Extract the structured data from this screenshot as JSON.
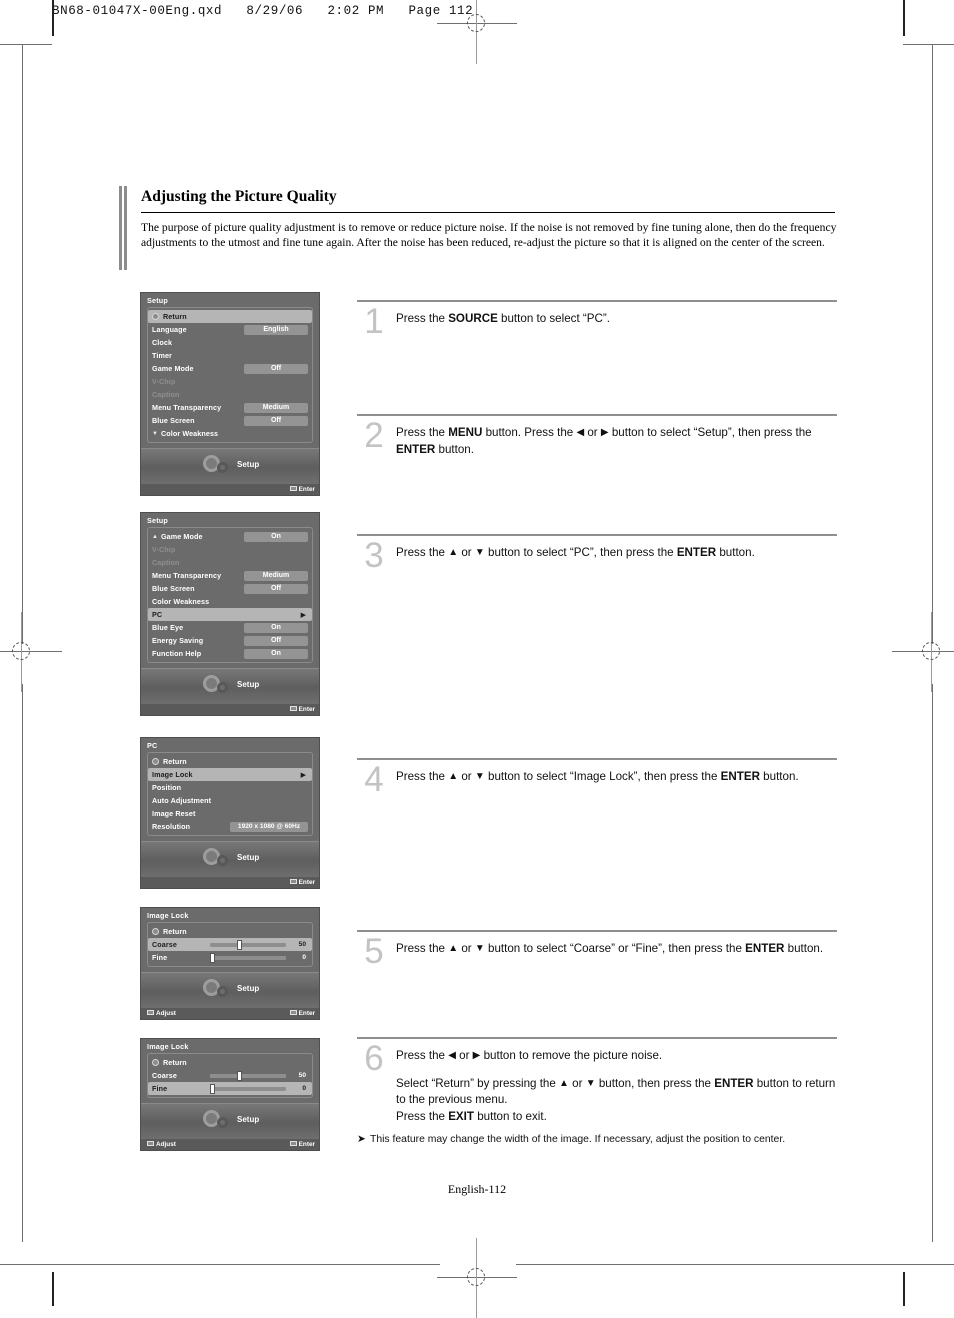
{
  "print_header": "BN68-01047X-00Eng.qxd   8/29/06   2:02 PM   Page 112",
  "page": {
    "title": "Adjusting the Picture Quality",
    "intro": "The purpose of picture quality adjustment is to remove or reduce picture noise. If the noise is not removed by fine tuning alone, then do the frequency adjustments to the utmost and fine tune again. After the noise has been reduced, re-adjust the picture so that it is aligned on the center of the screen.",
    "footer": "English-112",
    "note_marker": "➤",
    "note": "This feature may change the width of the image. If necessary, adjust the position to center."
  },
  "steps": [
    {
      "number": "1",
      "lines": [
        [
          {
            "t": "Press the ",
            "b": false
          },
          {
            "t": "SOURCE",
            "b": true
          },
          {
            "t": " button to select “PC”.",
            "b": false
          }
        ]
      ]
    },
    {
      "number": "2",
      "lines": [
        [
          {
            "t": "Press the ",
            "b": false
          },
          {
            "t": "MENU",
            "b": true
          },
          {
            "t": " button. Press the ",
            "b": false
          },
          {
            "t": "◀",
            "b": false,
            "arrow": true
          },
          {
            "t": " or ",
            "b": false
          },
          {
            "t": "▶",
            "b": false,
            "arrow": true
          },
          {
            "t": " button to select “Setup”, then press  the ",
            "b": false
          },
          {
            "t": "ENTER",
            "b": true
          },
          {
            "t": " button.",
            "b": false
          }
        ]
      ]
    },
    {
      "number": "3",
      "lines": [
        [
          {
            "t": "Press the ",
            "b": false
          },
          {
            "t": "▲",
            "b": false,
            "arrow": true
          },
          {
            "t": " or ",
            "b": false
          },
          {
            "t": "▼",
            "b": false,
            "arrow": true
          },
          {
            "t": " button to select “PC”, then press the ",
            "b": false
          },
          {
            "t": "ENTER",
            "b": true
          },
          {
            "t": " button.",
            "b": false
          }
        ]
      ]
    },
    {
      "number": "4",
      "lines": [
        [
          {
            "t": "Press the ",
            "b": false
          },
          {
            "t": "▲",
            "b": false,
            "arrow": true
          },
          {
            "t": " or ",
            "b": false
          },
          {
            "t": "▼",
            "b": false,
            "arrow": true
          },
          {
            "t": " button to select “Image Lock”, then press the ",
            "b": false
          },
          {
            "t": "ENTER",
            "b": true
          },
          {
            "t": " button.",
            "b": false
          }
        ]
      ]
    },
    {
      "number": "5",
      "lines": [
        [
          {
            "t": "Press the ",
            "b": false
          },
          {
            "t": "▲",
            "b": false,
            "arrow": true
          },
          {
            "t": " or ",
            "b": false
          },
          {
            "t": "▼",
            "b": false,
            "arrow": true
          },
          {
            "t": " button to select “Coarse” or “Fine”, then press the ",
            "b": false
          },
          {
            "t": "ENTER",
            "b": true
          },
          {
            "t": " button.",
            "b": false
          }
        ]
      ]
    },
    {
      "number": "6",
      "lines": [
        [
          {
            "t": "Press the ",
            "b": false
          },
          {
            "t": "◀",
            "b": false,
            "arrow": true
          },
          {
            "t": " or ",
            "b": false
          },
          {
            "t": "▶",
            "b": false,
            "arrow": true
          },
          {
            "t": " button to remove the picture noise.",
            "b": false
          }
        ],
        [
          {
            "t": "Select “Return” by pressing the ",
            "b": false
          },
          {
            "t": "▲",
            "b": false,
            "arrow": true
          },
          {
            "t": " or ",
            "b": false
          },
          {
            "t": "▼",
            "b": false,
            "arrow": true
          },
          {
            "t": " button, then press the ",
            "b": false
          },
          {
            "t": "ENTER",
            "b": true
          },
          {
            "t": " button to return to the previous menu.",
            "b": false
          },
          {
            "t": "\n",
            "b": false,
            "br": true
          },
          {
            "t": "Press the ",
            "b": false
          },
          {
            "t": "EXIT",
            "b": true
          },
          {
            "t": " button to exit.",
            "b": false
          }
        ]
      ]
    }
  ],
  "osd_menus": [
    {
      "title": "Setup",
      "foot_label": "Setup",
      "bottom_right": "Enter",
      "bottom_left": "",
      "items": [
        {
          "label": "Return",
          "type": "return",
          "selected": true
        },
        {
          "label": "Language",
          "value": "English"
        },
        {
          "label": "Clock"
        },
        {
          "label": "Timer"
        },
        {
          "label": "Game Mode",
          "value": "Off"
        },
        {
          "label": "V-Chip",
          "dim": true
        },
        {
          "label": "Caption",
          "dim": true
        },
        {
          "label": "Menu Transparency",
          "value": "Medium"
        },
        {
          "label": "Blue Screen",
          "value": "Off"
        },
        {
          "label": "Color Weakness",
          "caret": "▼"
        }
      ]
    },
    {
      "title": "Setup",
      "foot_label": "Setup",
      "bottom_right": "Enter",
      "bottom_left": "",
      "items": [
        {
          "label": "Game Mode",
          "value": "On",
          "caret": "▲"
        },
        {
          "label": "V-Chip",
          "dim": true
        },
        {
          "label": "Caption",
          "dim": true
        },
        {
          "label": "Menu Transparency",
          "value": "Medium"
        },
        {
          "label": "Blue Screen",
          "value": "Off"
        },
        {
          "label": "Color Weakness"
        },
        {
          "label": "PC",
          "selected": true,
          "arrow": "▶"
        },
        {
          "label": "Blue Eye",
          "value": "On"
        },
        {
          "label": "Energy Saving",
          "value": "Off"
        },
        {
          "label": "Function Help",
          "value": "On"
        }
      ]
    },
    {
      "title": "PC",
      "foot_label": "Setup",
      "bottom_right": "Enter",
      "bottom_left": "",
      "items": [
        {
          "label": "Return",
          "type": "return"
        },
        {
          "label": "Image Lock",
          "selected": true,
          "arrow": "▶"
        },
        {
          "label": "Position"
        },
        {
          "label": "Auto Adjustment"
        },
        {
          "label": "Image Reset"
        },
        {
          "label": "Resolution",
          "value": "1920 x 1080 @ 60Hz",
          "wide": true
        }
      ]
    },
    {
      "title": "Image Lock",
      "foot_label": "Setup",
      "bottom_right": "Enter",
      "bottom_left": "Adjust",
      "items": [
        {
          "label": "Return",
          "type": "return"
        },
        {
          "label": "Coarse",
          "type": "slider",
          "slider_value": "50",
          "slider_pct": 50,
          "selected": true
        },
        {
          "label": "Fine",
          "type": "slider",
          "slider_value": "0",
          "slider_pct": 0
        }
      ]
    },
    {
      "title": "Image Lock",
      "foot_label": "Setup",
      "bottom_right": "Enter",
      "bottom_left": "Adjust",
      "items": [
        {
          "label": "Return",
          "type": "return"
        },
        {
          "label": "Coarse",
          "type": "slider",
          "slider_value": "50",
          "slider_pct": 50
        },
        {
          "label": "Fine",
          "type": "slider",
          "slider_value": "0",
          "slider_pct": 0,
          "selected": true
        }
      ]
    }
  ]
}
